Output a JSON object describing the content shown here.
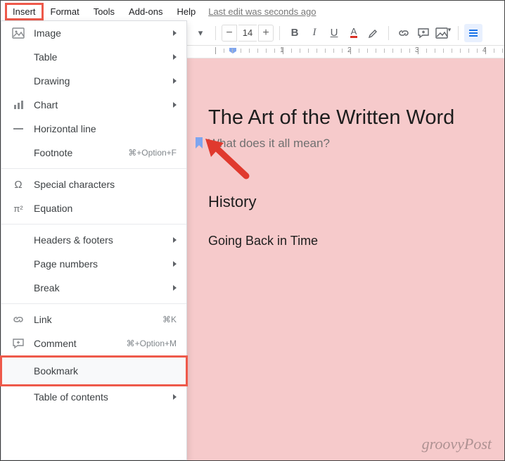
{
  "menubar": {
    "insert": "Insert",
    "format": "Format",
    "tools": "Tools",
    "addons": "Add-ons",
    "help": "Help",
    "edited": "Last edit was seconds ago"
  },
  "dropdown": {
    "image": "Image",
    "table": "Table",
    "drawing": "Drawing",
    "chart": "Chart",
    "hline": "Horizontal line",
    "footnote_label": "Footnote",
    "footnote_shortcut": "⌘+Option+F",
    "specialchars": "Special characters",
    "equation": "Equation",
    "headers": "Headers & footers",
    "pagenums": "Page numbers",
    "break": "Break",
    "link_label": "Link",
    "link_shortcut": "⌘K",
    "comment_label": "Comment",
    "comment_shortcut": "⌘+Option+M",
    "bookmark": "Bookmark",
    "toc": "Table of contents"
  },
  "toolbar": {
    "fontsize": "14",
    "bold": "B",
    "italic": "I",
    "underline": "U",
    "textcolor": "A"
  },
  "ruler": {
    "nums": [
      "1",
      "2",
      "3",
      "4"
    ]
  },
  "doc": {
    "title": "The Art of the Written Word",
    "subtitle": "What does it all mean?",
    "h2": "History",
    "para": "Going Back in Time"
  },
  "watermark": "groovyPost"
}
